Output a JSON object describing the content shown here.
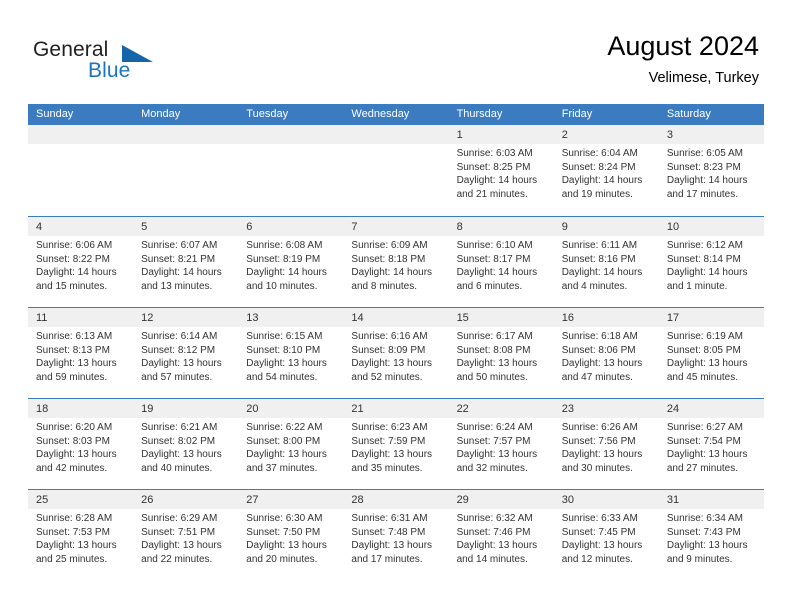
{
  "brand": {
    "name_part1": "General",
    "name_part2": "Blue",
    "accent_color": "#1c75bc",
    "flag_color": "#1565a9"
  },
  "header": {
    "title": "August 2024",
    "subtitle": "Velimese, Turkey"
  },
  "calendar": {
    "header_color": "#3b7cc0",
    "weekdays": [
      "Sunday",
      "Monday",
      "Tuesday",
      "Wednesday",
      "Thursday",
      "Friday",
      "Saturday"
    ],
    "weeks": [
      [
        {
          "day": "",
          "sunrise": "",
          "sunset": "",
          "daylight1": "",
          "daylight2": ""
        },
        {
          "day": "",
          "sunrise": "",
          "sunset": "",
          "daylight1": "",
          "daylight2": ""
        },
        {
          "day": "",
          "sunrise": "",
          "sunset": "",
          "daylight1": "",
          "daylight2": ""
        },
        {
          "day": "",
          "sunrise": "",
          "sunset": "",
          "daylight1": "",
          "daylight2": ""
        },
        {
          "day": "1",
          "sunrise": "Sunrise: 6:03 AM",
          "sunset": "Sunset: 8:25 PM",
          "daylight1": "Daylight: 14 hours",
          "daylight2": "and 21 minutes."
        },
        {
          "day": "2",
          "sunrise": "Sunrise: 6:04 AM",
          "sunset": "Sunset: 8:24 PM",
          "daylight1": "Daylight: 14 hours",
          "daylight2": "and 19 minutes."
        },
        {
          "day": "3",
          "sunrise": "Sunrise: 6:05 AM",
          "sunset": "Sunset: 8:23 PM",
          "daylight1": "Daylight: 14 hours",
          "daylight2": "and 17 minutes."
        }
      ],
      [
        {
          "day": "4",
          "sunrise": "Sunrise: 6:06 AM",
          "sunset": "Sunset: 8:22 PM",
          "daylight1": "Daylight: 14 hours",
          "daylight2": "and 15 minutes."
        },
        {
          "day": "5",
          "sunrise": "Sunrise: 6:07 AM",
          "sunset": "Sunset: 8:21 PM",
          "daylight1": "Daylight: 14 hours",
          "daylight2": "and 13 minutes."
        },
        {
          "day": "6",
          "sunrise": "Sunrise: 6:08 AM",
          "sunset": "Sunset: 8:19 PM",
          "daylight1": "Daylight: 14 hours",
          "daylight2": "and 10 minutes."
        },
        {
          "day": "7",
          "sunrise": "Sunrise: 6:09 AM",
          "sunset": "Sunset: 8:18 PM",
          "daylight1": "Daylight: 14 hours",
          "daylight2": "and 8 minutes."
        },
        {
          "day": "8",
          "sunrise": "Sunrise: 6:10 AM",
          "sunset": "Sunset: 8:17 PM",
          "daylight1": "Daylight: 14 hours",
          "daylight2": "and 6 minutes."
        },
        {
          "day": "9",
          "sunrise": "Sunrise: 6:11 AM",
          "sunset": "Sunset: 8:16 PM",
          "daylight1": "Daylight: 14 hours",
          "daylight2": "and 4 minutes."
        },
        {
          "day": "10",
          "sunrise": "Sunrise: 6:12 AM",
          "sunset": "Sunset: 8:14 PM",
          "daylight1": "Daylight: 14 hours",
          "daylight2": "and 1 minute."
        }
      ],
      [
        {
          "day": "11",
          "sunrise": "Sunrise: 6:13 AM",
          "sunset": "Sunset: 8:13 PM",
          "daylight1": "Daylight: 13 hours",
          "daylight2": "and 59 minutes."
        },
        {
          "day": "12",
          "sunrise": "Sunrise: 6:14 AM",
          "sunset": "Sunset: 8:12 PM",
          "daylight1": "Daylight: 13 hours",
          "daylight2": "and 57 minutes."
        },
        {
          "day": "13",
          "sunrise": "Sunrise: 6:15 AM",
          "sunset": "Sunset: 8:10 PM",
          "daylight1": "Daylight: 13 hours",
          "daylight2": "and 54 minutes."
        },
        {
          "day": "14",
          "sunrise": "Sunrise: 6:16 AM",
          "sunset": "Sunset: 8:09 PM",
          "daylight1": "Daylight: 13 hours",
          "daylight2": "and 52 minutes."
        },
        {
          "day": "15",
          "sunrise": "Sunrise: 6:17 AM",
          "sunset": "Sunset: 8:08 PM",
          "daylight1": "Daylight: 13 hours",
          "daylight2": "and 50 minutes."
        },
        {
          "day": "16",
          "sunrise": "Sunrise: 6:18 AM",
          "sunset": "Sunset: 8:06 PM",
          "daylight1": "Daylight: 13 hours",
          "daylight2": "and 47 minutes."
        },
        {
          "day": "17",
          "sunrise": "Sunrise: 6:19 AM",
          "sunset": "Sunset: 8:05 PM",
          "daylight1": "Daylight: 13 hours",
          "daylight2": "and 45 minutes."
        }
      ],
      [
        {
          "day": "18",
          "sunrise": "Sunrise: 6:20 AM",
          "sunset": "Sunset: 8:03 PM",
          "daylight1": "Daylight: 13 hours",
          "daylight2": "and 42 minutes."
        },
        {
          "day": "19",
          "sunrise": "Sunrise: 6:21 AM",
          "sunset": "Sunset: 8:02 PM",
          "daylight1": "Daylight: 13 hours",
          "daylight2": "and 40 minutes."
        },
        {
          "day": "20",
          "sunrise": "Sunrise: 6:22 AM",
          "sunset": "Sunset: 8:00 PM",
          "daylight1": "Daylight: 13 hours",
          "daylight2": "and 37 minutes."
        },
        {
          "day": "21",
          "sunrise": "Sunrise: 6:23 AM",
          "sunset": "Sunset: 7:59 PM",
          "daylight1": "Daylight: 13 hours",
          "daylight2": "and 35 minutes."
        },
        {
          "day": "22",
          "sunrise": "Sunrise: 6:24 AM",
          "sunset": "Sunset: 7:57 PM",
          "daylight1": "Daylight: 13 hours",
          "daylight2": "and 32 minutes."
        },
        {
          "day": "23",
          "sunrise": "Sunrise: 6:26 AM",
          "sunset": "Sunset: 7:56 PM",
          "daylight1": "Daylight: 13 hours",
          "daylight2": "and 30 minutes."
        },
        {
          "day": "24",
          "sunrise": "Sunrise: 6:27 AM",
          "sunset": "Sunset: 7:54 PM",
          "daylight1": "Daylight: 13 hours",
          "daylight2": "and 27 minutes."
        }
      ],
      [
        {
          "day": "25",
          "sunrise": "Sunrise: 6:28 AM",
          "sunset": "Sunset: 7:53 PM",
          "daylight1": "Daylight: 13 hours",
          "daylight2": "and 25 minutes."
        },
        {
          "day": "26",
          "sunrise": "Sunrise: 6:29 AM",
          "sunset": "Sunset: 7:51 PM",
          "daylight1": "Daylight: 13 hours",
          "daylight2": "and 22 minutes."
        },
        {
          "day": "27",
          "sunrise": "Sunrise: 6:30 AM",
          "sunset": "Sunset: 7:50 PM",
          "daylight1": "Daylight: 13 hours",
          "daylight2": "and 20 minutes."
        },
        {
          "day": "28",
          "sunrise": "Sunrise: 6:31 AM",
          "sunset": "Sunset: 7:48 PM",
          "daylight1": "Daylight: 13 hours",
          "daylight2": "and 17 minutes."
        },
        {
          "day": "29",
          "sunrise": "Sunrise: 6:32 AM",
          "sunset": "Sunset: 7:46 PM",
          "daylight1": "Daylight: 13 hours",
          "daylight2": "and 14 minutes."
        },
        {
          "day": "30",
          "sunrise": "Sunrise: 6:33 AM",
          "sunset": "Sunset: 7:45 PM",
          "daylight1": "Daylight: 13 hours",
          "daylight2": "and 12 minutes."
        },
        {
          "day": "31",
          "sunrise": "Sunrise: 6:34 AM",
          "sunset": "Sunset: 7:43 PM",
          "daylight1": "Daylight: 13 hours",
          "daylight2": "and 9 minutes."
        }
      ]
    ]
  }
}
